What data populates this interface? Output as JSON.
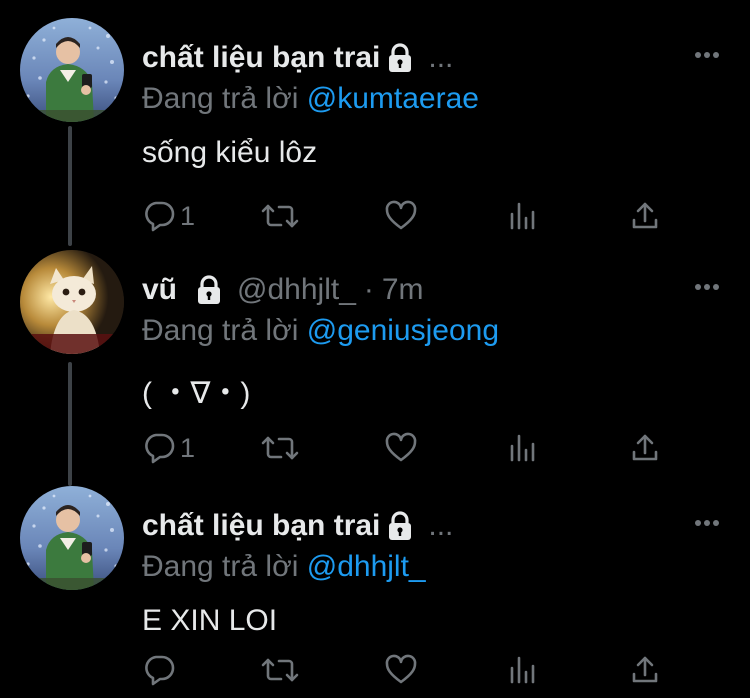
{
  "tweets": [
    {
      "display_name": "chất liệu bạn trai",
      "handle": "",
      "dot": "",
      "time": "",
      "overflow": "...",
      "replying_prefix": "Đang trả lời",
      "replying_to": "@kumtaerae",
      "text": "sống kiểu lôz",
      "reply_count": "1",
      "avatar_icon": "avatar-boy-green-vest"
    },
    {
      "display_name": "vũ",
      "handle": "@dhhjlt_",
      "dot": "·",
      "time": "7m",
      "overflow": "",
      "replying_prefix": "Đang trả lời",
      "replying_to": "@geniusjeong",
      "text": "(  ・∇・)",
      "reply_count": "1",
      "avatar_icon": "avatar-cat"
    },
    {
      "display_name": "chất liệu bạn trai",
      "handle": "",
      "dot": "",
      "time": "",
      "overflow": "...",
      "replying_prefix": "Đang trả lời",
      "replying_to": "@dhhjlt_",
      "text": "E XIN LOI",
      "reply_count": "",
      "avatar_icon": "avatar-boy-green-vest"
    }
  ],
  "colors": {
    "background": "#000000",
    "primary_text": "#e7e9ea",
    "secondary_text": "#71767b",
    "link": "#1d9bf0",
    "thread_line": "#3d4247"
  },
  "icons": [
    "reply-icon",
    "retweet-icon",
    "like-icon",
    "analytics-icon",
    "share-icon",
    "lock-icon",
    "more-icon"
  ]
}
